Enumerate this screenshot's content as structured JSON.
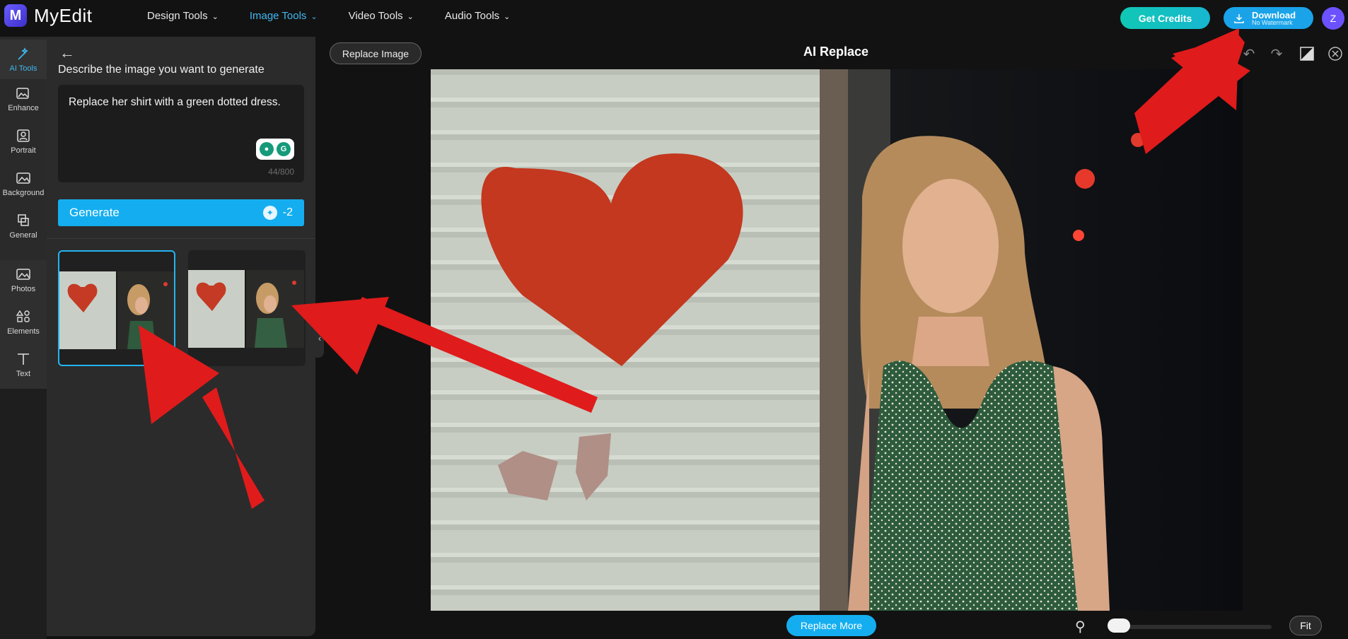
{
  "app": {
    "name": "MyEdit",
    "logo_letter": "M"
  },
  "nav": {
    "items": [
      {
        "label": "Design Tools"
      },
      {
        "label": "Image Tools"
      },
      {
        "label": "Video Tools"
      },
      {
        "label": "Audio Tools"
      }
    ]
  },
  "header": {
    "get_credits": "Get Credits",
    "download": "Download",
    "download_sub": "No Watermark",
    "avatar_initial": "Z"
  },
  "rail": {
    "items": [
      {
        "label": "AI Tools",
        "icon": "magic-wand-icon"
      },
      {
        "label": "Enhance",
        "icon": "enhance-icon"
      },
      {
        "label": "Portrait",
        "icon": "portrait-icon"
      },
      {
        "label": "Background",
        "icon": "background-icon"
      },
      {
        "label": "General",
        "icon": "general-icon"
      },
      {
        "label": "Photos",
        "icon": "photos-icon"
      },
      {
        "label": "Elements",
        "icon": "elements-icon"
      },
      {
        "label": "Text",
        "icon": "text-icon"
      }
    ]
  },
  "panel": {
    "title": "Describe the image you want to generate",
    "prompt": "Replace her shirt with a green dotted dress.",
    "counter": "44/800",
    "generate_label": "Generate",
    "generate_cost": "-2"
  },
  "canvas": {
    "replace_image": "Replace Image",
    "title": "AI Replace",
    "replace_more": "Replace More",
    "fit": "Fit"
  },
  "colors": {
    "accent": "#14aef0",
    "credits": "#10c8b4",
    "arrow": "#e01b1b"
  }
}
